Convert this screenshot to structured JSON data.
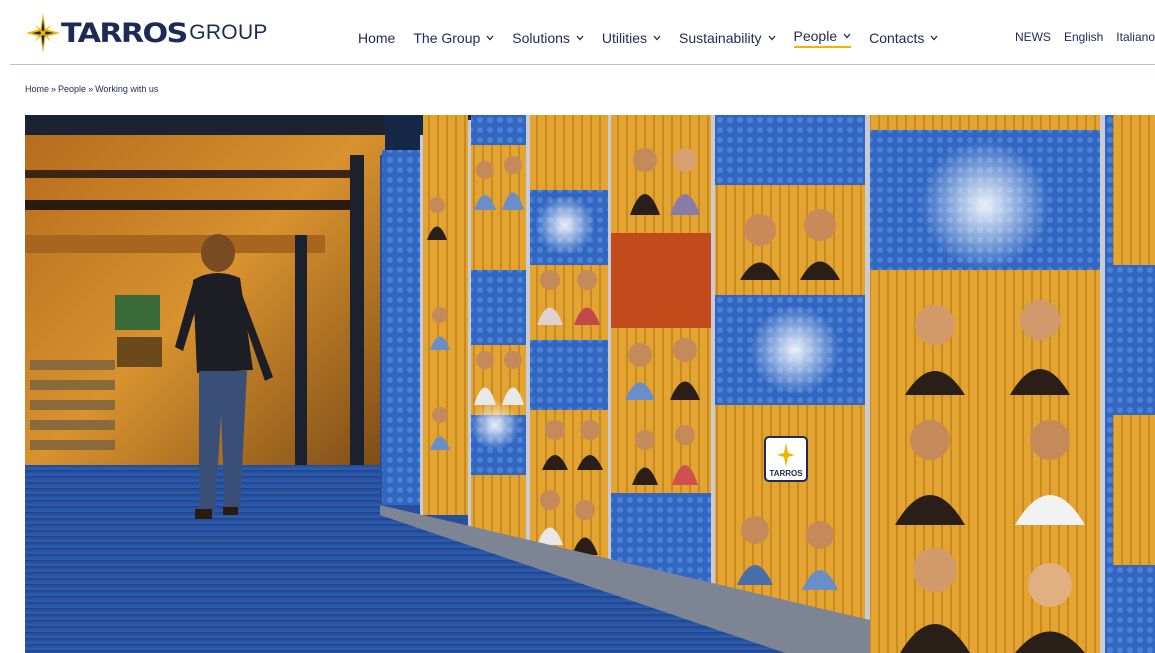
{
  "logo": {
    "wordmark": "TARROS",
    "suffix": "GROUP"
  },
  "nav": {
    "items": [
      {
        "label": "Home",
        "dropdown": false,
        "active": false
      },
      {
        "label": "The Group",
        "dropdown": true,
        "active": false
      },
      {
        "label": "Solutions",
        "dropdown": true,
        "active": false
      },
      {
        "label": "Utilities",
        "dropdown": true,
        "active": false
      },
      {
        "label": "Sustainability",
        "dropdown": true,
        "active": false
      },
      {
        "label": "People",
        "dropdown": true,
        "active": true
      },
      {
        "label": "Contacts",
        "dropdown": true,
        "active": false
      }
    ]
  },
  "utility": {
    "news": "NEWS",
    "english": "English",
    "italiano": "Italiano"
  },
  "breadcrumb": {
    "home": "Home",
    "people": "People",
    "current": "Working with us",
    "separator": "»"
  },
  "hero": {
    "wall_logo": "TARROS"
  },
  "colors": {
    "navy": "#1d2a55",
    "accent": "#f0b400",
    "wall_blue": "#2f5fb4",
    "wall_orange": "#e3a22e"
  }
}
